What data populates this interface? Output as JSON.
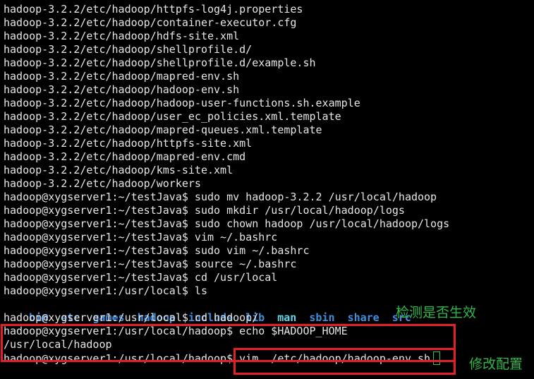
{
  "terminal": {
    "lines": [
      "hadoop-3.2.2/etc/hadoop/httpfs-log4j.properties",
      "hadoop-3.2.2/etc/hadoop/container-executor.cfg",
      "hadoop-3.2.2/etc/hadoop/hdfs-site.xml",
      "hadoop-3.2.2/etc/hadoop/shellprofile.d/",
      "hadoop-3.2.2/etc/hadoop/shellprofile.d/example.sh",
      "hadoop-3.2.2/etc/hadoop/mapred-env.sh",
      "hadoop-3.2.2/etc/hadoop/hadoop-env.sh",
      "hadoop-3.2.2/etc/hadoop/hadoop-user-functions.sh.example",
      "hadoop-3.2.2/etc/hadoop/user_ec_policies.xml.template",
      "hadoop-3.2.2/etc/hadoop/mapred-queues.xml.template",
      "hadoop-3.2.2/etc/hadoop/httpfs-site.xml",
      "hadoop-3.2.2/etc/hadoop/mapred-env.cmd",
      "hadoop-3.2.2/etc/hadoop/kms-site.xml",
      "hadoop-3.2.2/etc/hadoop/workers",
      "hadoop@xygserver1:~/testJava$ sudo mv hadoop-3.2.2 /usr/local/hadoop",
      "hadoop@xygserver1:~/testJava$ sudo mkdir /usr/local/hadoop/logs",
      "hadoop@xygserver1:~/testJava$ sudo chown hadoop /usr/local/hadoop/logs",
      "hadoop@xygserver1:~/testJava$ vim ~/.bashrc",
      "hadoop@xygserver1:~/testJava$ sudo vim ~/.bashrc",
      "hadoop@xygserver1:~/testJava$ source ~/.bashrc",
      "hadoop@xygserver1:~/testJava$ cd /usr/local",
      "hadoop@xygserver1:/usr/local$ ls"
    ],
    "ls_output": [
      "bin",
      "etc",
      "games",
      "hadoop",
      "include",
      "lib",
      "man",
      "sbin",
      "share",
      "src"
    ],
    "after_lines": [
      "hadoop@xygserver1:/usr/local$ cd hadoop/",
      "hadoop@xygserver1:/usr/local/hadoop$ echo $HADOOP_HOME",
      "/usr/local/hadoop"
    ],
    "last_prompt": "hadoop@xygserver1:/usr/local/hadoop$ ",
    "last_command": "vim ./etc/hadoop/hadoop-env.sh"
  },
  "annotations": {
    "check_label": "检测是否生效",
    "modify_label": "修改配置"
  },
  "colors": {
    "directory": "#3f8fe0",
    "annotation": "#2fb84c",
    "highlight_box": "#e3202a"
  }
}
